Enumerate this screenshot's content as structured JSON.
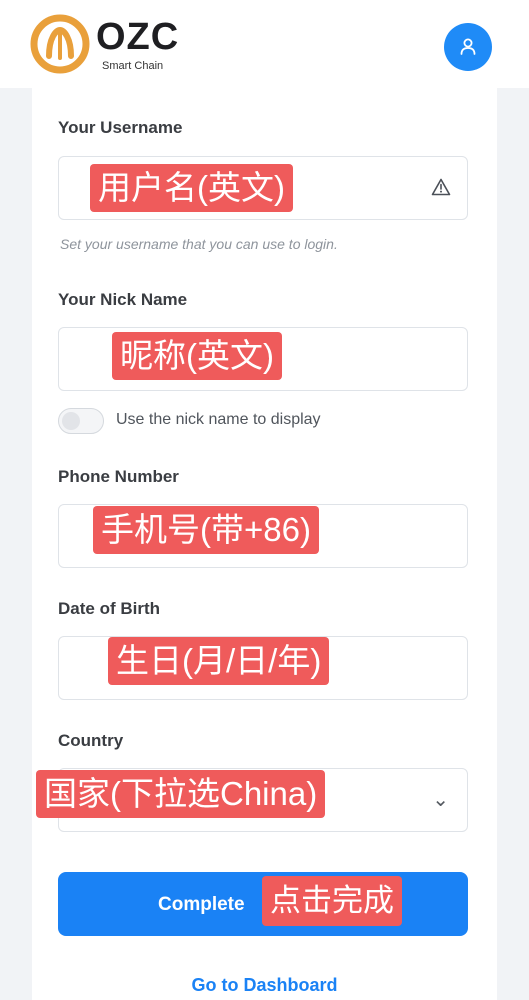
{
  "header": {
    "brand_name": "OZC",
    "brand_tagline": "Smart Chain"
  },
  "form": {
    "username": {
      "label": "Your Username",
      "hint": "Set your username that you can use to login."
    },
    "nickname": {
      "label": "Your Nick Name",
      "toggle_label": "Use the nick name to display",
      "toggle_on": false
    },
    "phone": {
      "label": "Phone Number"
    },
    "dob": {
      "label": "Date of Birth"
    },
    "country": {
      "label": "Country"
    },
    "submit_label": "Complete",
    "dashboard_link": "Go to Dashboard"
  },
  "annotations": {
    "username": "用户名(英文)",
    "nickname": "昵称(英文)",
    "phone": "手机号(带+86)",
    "dob": "生日(月/日/年)",
    "country": "国家(下拉选China)",
    "submit": "点击完成"
  },
  "colors": {
    "accent": "#1a82f5",
    "annotation_bg": "#ef5b5b",
    "logo_ring": "#e9a03b"
  },
  "icons": {
    "avatar": "user-icon",
    "username_status": "warning-icon",
    "country_select": "chevron-down-icon",
    "logo": "ozc-logo-icon"
  }
}
